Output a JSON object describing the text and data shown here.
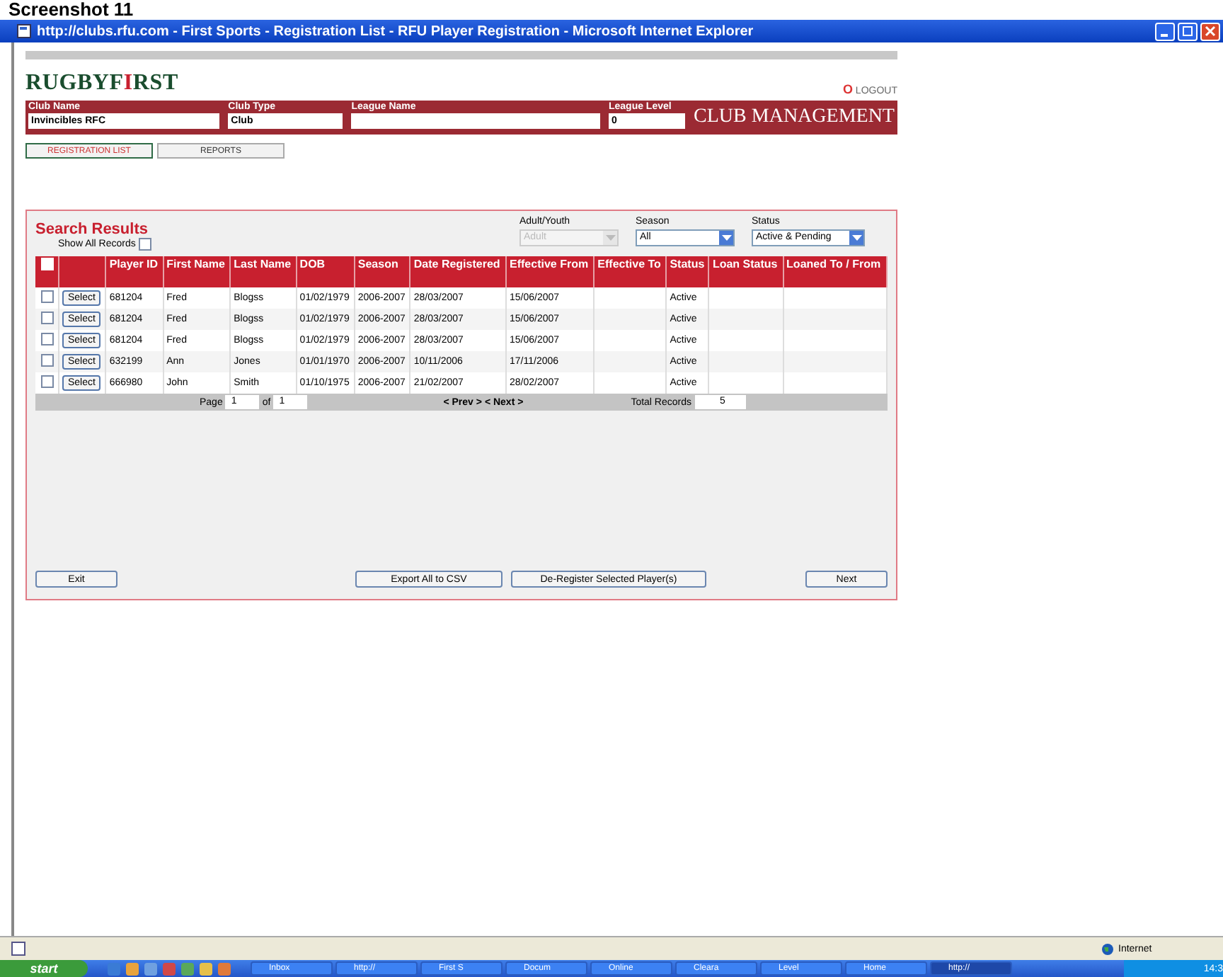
{
  "heading": "Screenshot 11",
  "window": {
    "title": "http://clubs.rfu.com - First Sports - Registration List - RFU Player Registration - Microsoft Internet Explorer"
  },
  "logo": {
    "part1": "RUGBYF",
    "part2": "I",
    "part3": "RST"
  },
  "logout": {
    "mark": "O",
    "label": "LOGOUT"
  },
  "club_fields": [
    {
      "label": "Club Name",
      "value": "Invincibles RFC"
    },
    {
      "label": "Club Type",
      "value": "Club"
    },
    {
      "label": "League Name"
    },
    {
      "label": "League Level",
      "value": "0"
    }
  ],
  "banner_title": "CLUB MANAGEMENT",
  "tabs": [
    {
      "label": "REGISTRATION LIST",
      "selected": true
    },
    {
      "label": "REPORTS",
      "selected": false
    }
  ],
  "search": {
    "title": "Search Results",
    "show_all_label": "Show All Records",
    "show_all_checked": false
  },
  "filters": [
    {
      "label": "Adult/Youth",
      "value": "Adult",
      "disabled": true
    },
    {
      "label": "Season",
      "value": "All",
      "disabled": false
    },
    {
      "label": "Status",
      "value": "Active & Pending",
      "disabled": false
    }
  ],
  "table": {
    "columns": [
      "Player ID",
      "First Name",
      "Last Name",
      "DOB",
      "Season",
      "Date Registered",
      "Effective From",
      "Effective To",
      "Status",
      "Loan Status",
      "Loaned To / From"
    ],
    "select_all_checked": false,
    "rows": [
      {
        "checked": false,
        "select_label": "Select",
        "cells": [
          "681204",
          "Fred",
          "Blogss",
          "01/02/1979",
          "2006-2007",
          "28/03/2007",
          "15/06/2007",
          null,
          "Active",
          null,
          null
        ]
      },
      {
        "checked": false,
        "select_label": "Select",
        "cells": [
          "681204",
          "Fred",
          "Blogss",
          "01/02/1979",
          "2006-2007",
          "28/03/2007",
          "15/06/2007",
          null,
          "Active",
          null,
          null
        ]
      },
      {
        "checked": false,
        "select_label": "Select",
        "cells": [
          "681204",
          "Fred",
          "Blogss",
          "01/02/1979",
          "2006-2007",
          "28/03/2007",
          "15/06/2007",
          null,
          "Active",
          null,
          null
        ]
      },
      {
        "checked": false,
        "select_label": "Select",
        "cells": [
          "632199",
          "Ann",
          "Jones",
          "01/01/1970",
          "2006-2007",
          "10/11/2006",
          "17/11/2006",
          null,
          "Active",
          null,
          null
        ]
      },
      {
        "checked": false,
        "select_label": "Select",
        "cells": [
          "666980",
          "John",
          "Smith",
          "01/10/1975",
          "2006-2007",
          "21/02/2007",
          "28/02/2007",
          null,
          "Active",
          null,
          null
        ]
      }
    ]
  },
  "pager": {
    "page_label": "Page",
    "page": "1",
    "of_label": "of",
    "pages": "1",
    "prev": "< Prev >",
    "next": "< Next >",
    "total_label": "Total Records",
    "total": "5"
  },
  "buttons": [
    {
      "label": "Exit"
    },
    {
      "label": "Export All to CSV"
    },
    {
      "label": "De-Register Selected Player(s)"
    },
    {
      "label": "Next"
    }
  ],
  "status_bar": {
    "zone": "Internet"
  },
  "taskbar": {
    "start": "start",
    "tasks": [
      {
        "label": "Inbox",
        "selected": false
      },
      {
        "label": "http://",
        "selected": false
      },
      {
        "label": "First S",
        "selected": false
      },
      {
        "label": "Docum",
        "selected": false
      },
      {
        "label": "Online",
        "selected": false
      },
      {
        "label": "Cleara",
        "selected": false
      },
      {
        "label": "Level",
        "selected": false
      },
      {
        "label": "Home",
        "selected": false
      },
      {
        "label": "http://",
        "selected": true
      }
    ],
    "clock": "14:3"
  }
}
